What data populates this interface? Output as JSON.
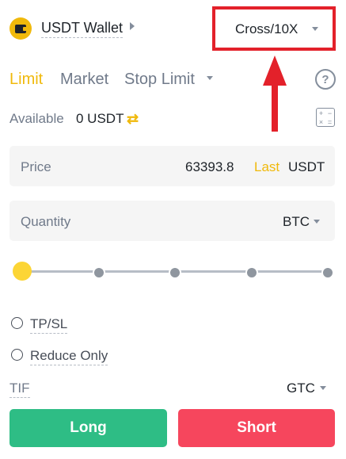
{
  "header": {
    "wallet_label": "USDT Wallet",
    "margin_mode": "Cross/10X"
  },
  "tabs": {
    "limit": "Limit",
    "market": "Market",
    "stop_limit": "Stop Limit"
  },
  "help_icon": "?",
  "available": {
    "label": "Available",
    "value": "0 USDT",
    "icon": "transfer-icon"
  },
  "price": {
    "label": "Price",
    "value": "63393.8",
    "tag": "Last",
    "unit": "USDT"
  },
  "quantity": {
    "label": "Quantity",
    "unit": "BTC"
  },
  "slider": {
    "value_percent": 0,
    "stops": [
      0,
      25,
      50,
      75,
      100
    ]
  },
  "options": {
    "tpsl_label": "TP/SL",
    "reduce_only_label": "Reduce Only"
  },
  "tif": {
    "label": "TIF",
    "value": "GTC"
  },
  "buttons": {
    "long": "Long",
    "short": "Short"
  },
  "colors": {
    "accent": "#f0b90b",
    "long": "#2ebd85",
    "short": "#f6465d",
    "annotation": "#e3212a"
  }
}
